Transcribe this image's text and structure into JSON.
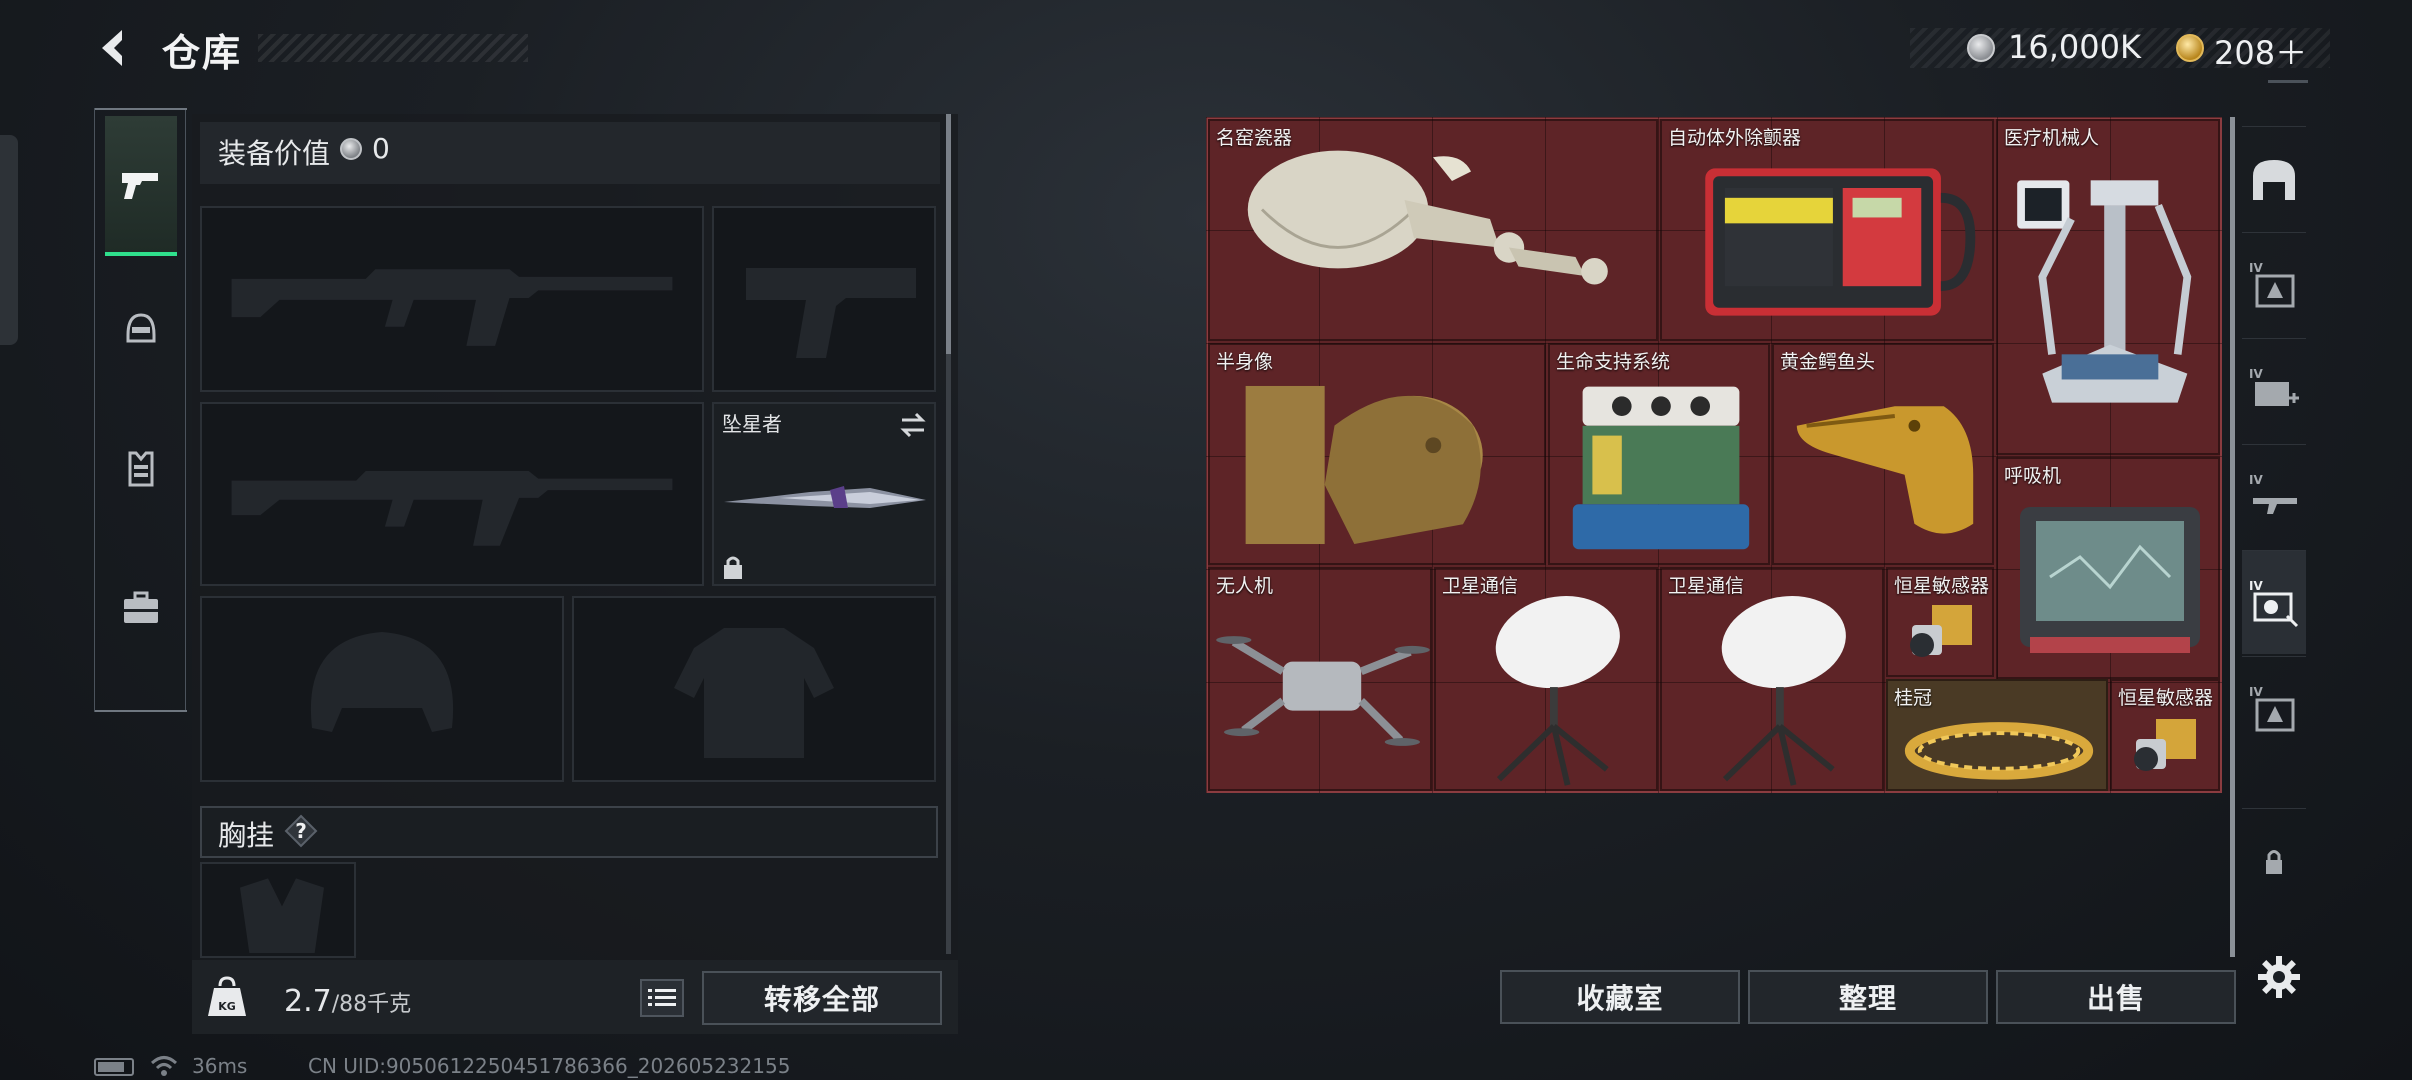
{
  "header": {
    "title": "仓库",
    "currency": {
      "coins": "16,000K",
      "premium": "208＋"
    }
  },
  "left_tabs": [
    "weapon-tab",
    "helmet-tab",
    "vest-tab",
    "backpack-tab"
  ],
  "equipment": {
    "value_label": "装备价值",
    "value": "0",
    "melee_slot_name": "坠星者",
    "chest_rig_label": "胸挂",
    "help_glyph": "?",
    "weight_value": "2.7",
    "weight_capacity": "/88千克",
    "transfer_all": "转移全部"
  },
  "storage": {
    "items": [
      {
        "name": "名窑瓷器"
      },
      {
        "name": "自动体外除颤器"
      },
      {
        "name": "医疗机械人"
      },
      {
        "name": "半身像"
      },
      {
        "name": "生命支持系统"
      },
      {
        "name": "黄金鳄鱼头"
      },
      {
        "name": "呼吸机"
      },
      {
        "name": "无人机"
      },
      {
        "name": "卫星通信"
      },
      {
        "name": "卫星通信"
      },
      {
        "name": "恒星敏感器"
      },
      {
        "name": "桂冠"
      },
      {
        "name": "恒星敏感器"
      }
    ],
    "tint_color": "#5e2427"
  },
  "actions": {
    "collection": "收藏室",
    "sort": "整理",
    "sell": "出售"
  },
  "status_bar": {
    "ping": "36ms",
    "uid": "CN UID:9050612250451786366_202605232155"
  },
  "colors": {
    "accent": "#2fe08c",
    "grid": "#5e2427"
  }
}
